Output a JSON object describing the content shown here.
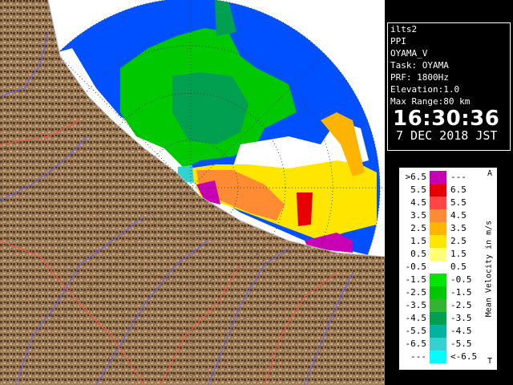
{
  "info": {
    "site": "ilts2",
    "product": "PPI",
    "station": "OYAMA_V",
    "task": "Task: OYAMA",
    "prf": "PRF: 1800Hz",
    "elevation": "Elevation:1.0",
    "max_range": "Max Range:80 km",
    "time": "16:30:36",
    "date": "7 DEC 2018 JST"
  },
  "legend": {
    "unit_label": "Mean Velocity in m/s",
    "top_marker": "A",
    "bottom_marker": "T",
    "rows": [
      {
        "lo": ">6.5",
        "hi": "---",
        "color": "#c800b4"
      },
      {
        "lo": "5.5",
        "hi": "6.5",
        "color": "#e60000"
      },
      {
        "lo": "4.5",
        "hi": "5.5",
        "color": "#ff4646"
      },
      {
        "lo": "3.5",
        "hi": "4.5",
        "color": "#ff8c32"
      },
      {
        "lo": "2.5",
        "hi": "3.5",
        "color": "#ffb400"
      },
      {
        "lo": "1.5",
        "hi": "2.5",
        "color": "#ffe600"
      },
      {
        "lo": "0.5",
        "hi": "1.5",
        "color": "#ffff78"
      },
      {
        "lo": "-0.5",
        "hi": "0.5",
        "color": "#ffffff"
      },
      {
        "lo": "-1.5",
        "hi": "-0.5",
        "color": "#00e600"
      },
      {
        "lo": "-2.5",
        "hi": "-1.5",
        "color": "#00c800"
      },
      {
        "lo": "-3.5",
        "hi": "-2.5",
        "color": "#32b432"
      },
      {
        "lo": "-4.5",
        "hi": "-3.5",
        "color": "#00a050"
      },
      {
        "lo": "-5.5",
        "hi": "-4.5",
        "color": "#00b4a0"
      },
      {
        "lo": "-6.5",
        "hi": "-5.5",
        "color": "#32d2d2"
      },
      {
        "lo": "---",
        "hi": "<-6.5",
        "color": "#00ffff"
      }
    ]
  },
  "map": {
    "sea_color": "#0050ff",
    "no_coverage_color": "#ffffff",
    "land_color": "#9b7a55"
  }
}
